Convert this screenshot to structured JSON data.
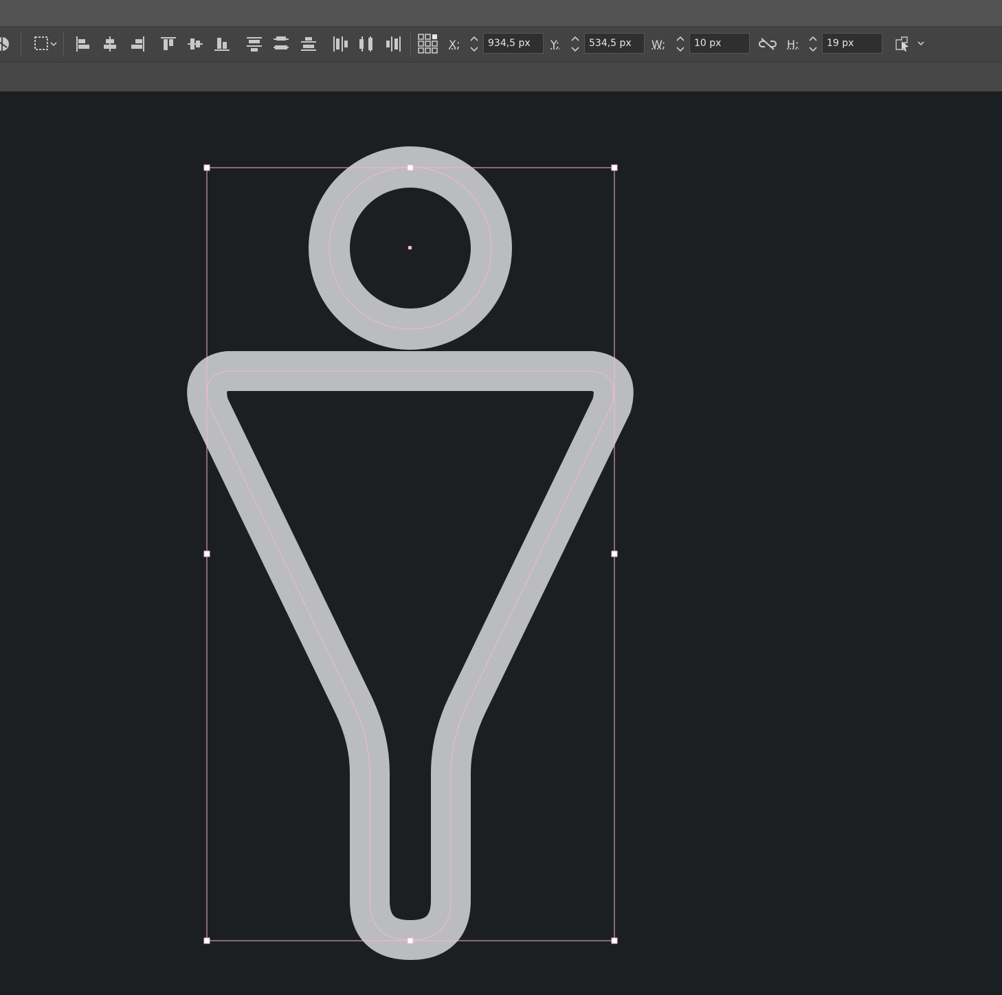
{
  "options_bar": {
    "tools": [
      {
        "name": "path-alignment-icon"
      },
      {
        "name": "marquee-options-icon"
      },
      {
        "name": "align-left-edges-icon"
      },
      {
        "name": "align-horizontal-centers-icon"
      },
      {
        "name": "align-right-edges-icon"
      },
      {
        "name": "align-top-edges-icon"
      },
      {
        "name": "align-vertical-centers-icon"
      },
      {
        "name": "align-bottom-edges-icon"
      },
      {
        "name": "distribute-top-icon"
      },
      {
        "name": "distribute-vertical-centers-icon"
      },
      {
        "name": "distribute-bottom-icon"
      },
      {
        "name": "distribute-left-icon"
      },
      {
        "name": "distribute-horizontal-centers-icon"
      },
      {
        "name": "distribute-right-icon"
      },
      {
        "name": "reference-point-grid-icon"
      }
    ],
    "x_label": "X:",
    "x_value": "934,5 px",
    "y_label": "Y:",
    "y_value": "534,5 px",
    "w_label": "W:",
    "w_value": "10 px",
    "link_icon": "unlink-icon",
    "h_label": "H:",
    "h_value": "19 px",
    "warp_icon": "warp-transform-icon"
  },
  "canvas": {
    "background": "#1b1f22",
    "shape_color": "#bbbcbe",
    "bbox_color": "#f5b6da",
    "shape": "person-icon-outline"
  }
}
